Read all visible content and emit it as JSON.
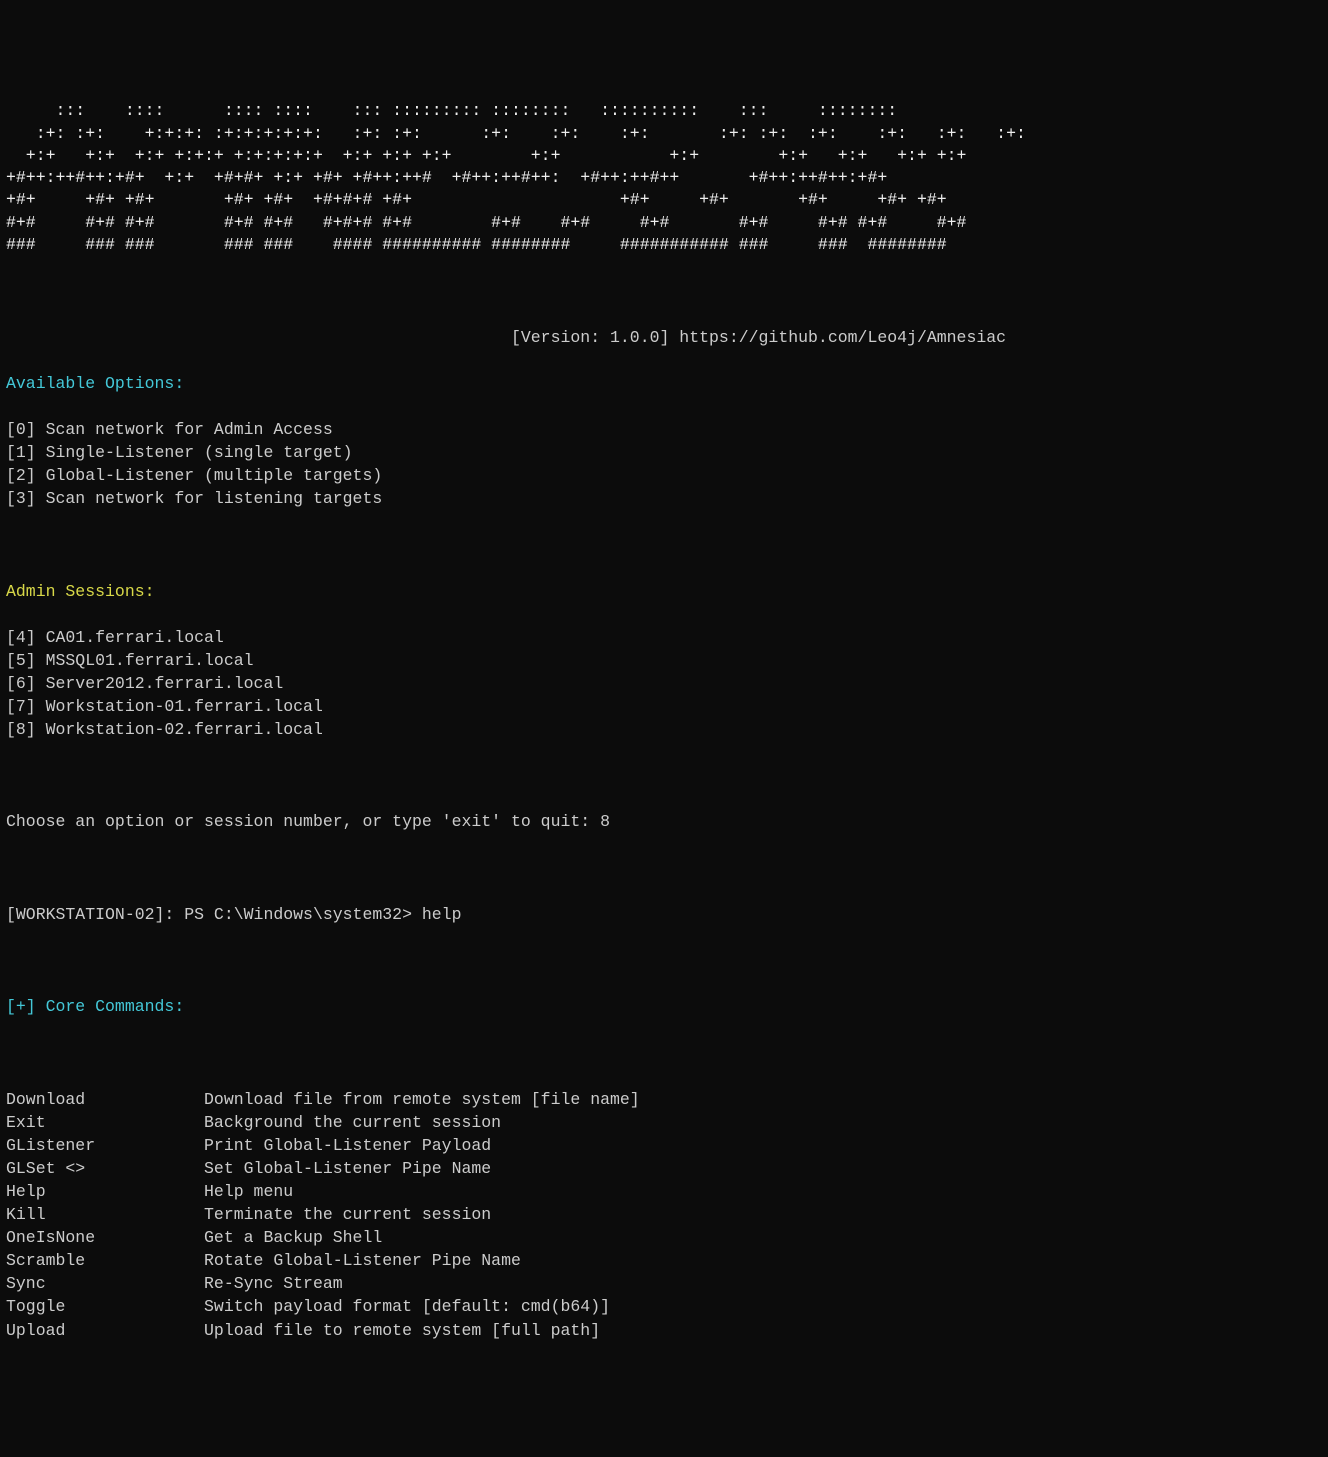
{
  "ascii_art": "     :::    ::::      :::: ::::    ::: ::::::::: ::::::::   ::::::::::    :::     ::::::::\n   :+: :+:    +:+:+: :+:+:+:+:+:   :+: :+:      :+:    :+:    :+:       :+: :+:  :+:    :+:   :+:   :+:\n  +:+   +:+  +:+ +:+:+ +:+:+:+:+  +:+ +:+ +:+        +:+           +:+        +:+   +:+   +:+ +:+\n+#++:++#++:+#+  +:+  +#+#+ +:+ +#+ +#++:++#  +#++:++#++:  +#++:++#++       +#++:++#++:+#+\n+#+     +#+ +#+       +#+ +#+  +#+#+# +#+                     +#+     +#+       +#+     +#+ +#+\n#+#     #+# #+#       #+# #+#   #+#+# #+#        #+#    #+#     #+#       #+#     #+# #+#     #+#\n###     ### ###       ### ###    #### ########## ########     ########### ###     ###  ########",
  "version_line": "                                                   [Version: 1.0.0] https://github.com/Leo4j/Amnesiac",
  "available_options_header": "Available Options:",
  "options": [
    "[0] Scan network for Admin Access",
    "[1] Single-Listener (single target)",
    "[2] Global-Listener (multiple targets)",
    "[3] Scan network for listening targets"
  ],
  "admin_sessions_header": "Admin Sessions:",
  "sessions": [
    "[4] CA01.ferrari.local",
    "[5] MSSQL01.ferrari.local",
    "[6] Server2012.ferrari.local",
    "[7] Workstation-01.ferrari.local",
    "[8] Workstation-02.ferrari.local"
  ],
  "choose_prompt": "Choose an option or session number, or type 'exit' to quit: 8",
  "shell_prompt": "[WORKSTATION-02]: PS C:\\Windows\\system32> help",
  "core_commands_header": "[+] Core Commands:",
  "commands": [
    {
      "name": "Download",
      "desc": "Download file from remote system [file name]"
    },
    {
      "name": "Exit",
      "desc": "Background the current session"
    },
    {
      "name": "GListener",
      "desc": "Print Global-Listener Payload"
    },
    {
      "name": "GLSet <>",
      "desc": "Set Global-Listener Pipe Name"
    },
    {
      "name": "Help",
      "desc": "Help menu"
    },
    {
      "name": "Kill",
      "desc": "Terminate the current session"
    },
    {
      "name": "OneIsNone",
      "desc": "Get a Backup Shell"
    },
    {
      "name": "Scramble",
      "desc": "Rotate Global-Listener Pipe Name"
    },
    {
      "name": "Sync",
      "desc": "Re-Sync Stream"
    },
    {
      "name": "Toggle",
      "desc": "Switch payload format [default: cmd(b64)]"
    },
    {
      "name": "Upload",
      "desc": "Upload file to remote system [full path]"
    }
  ]
}
